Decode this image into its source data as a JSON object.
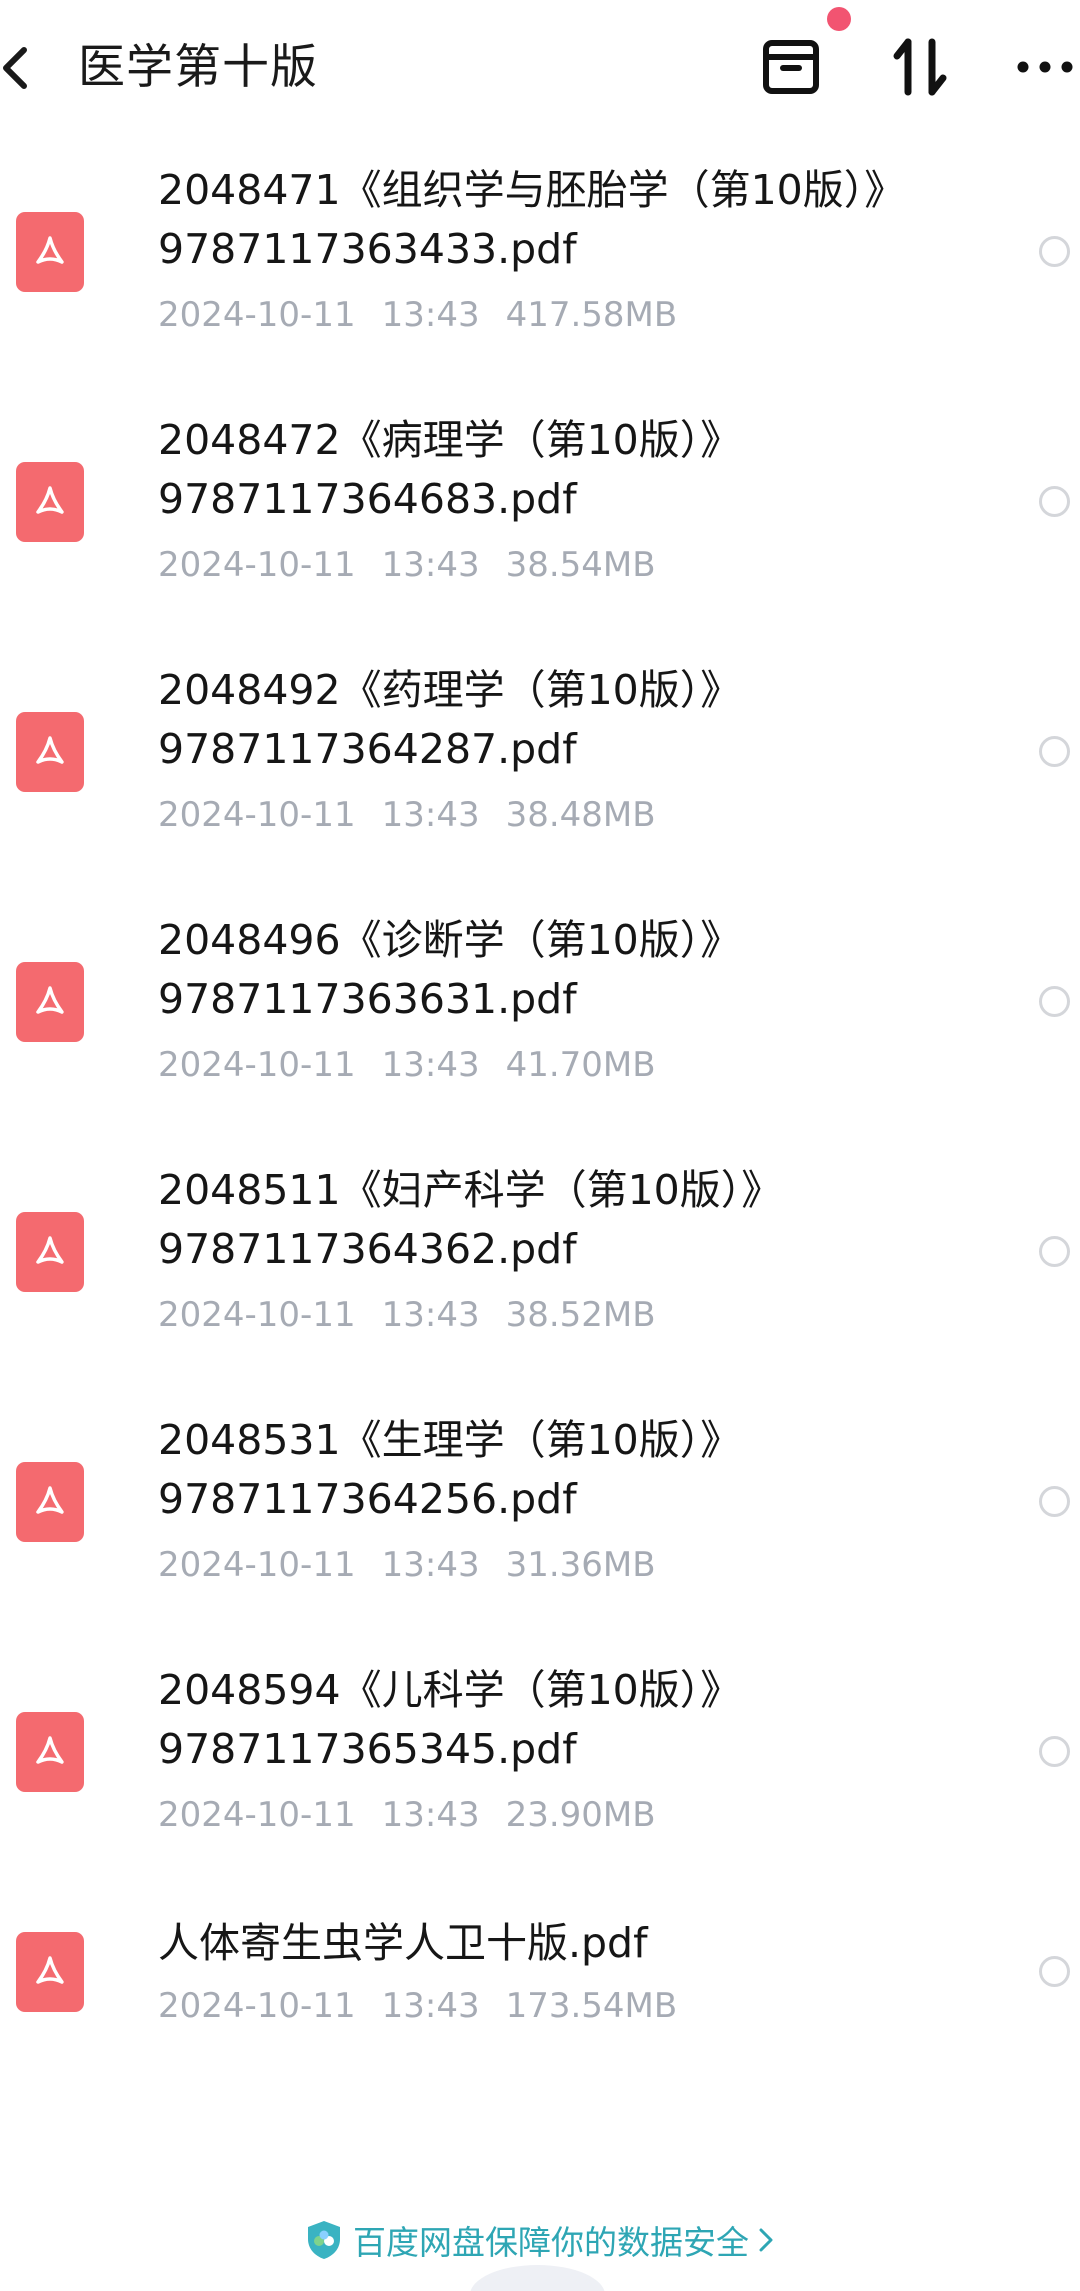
{
  "header": {
    "title": "医学第十版",
    "icons": {
      "back": "chevron-left-icon",
      "archive": "archive-box-icon",
      "sort": "sort-arrows-icon",
      "more": "more-dots-icon"
    },
    "notification_dot_color": "#f25471"
  },
  "files": [
    {
      "name_line1": "2048471《组织学与胚胎学（第10版）》",
      "name_line2": "9787117363433.pdf",
      "date": "2024-10-11",
      "time": "13:43",
      "size": "417.58MB",
      "icon": "pdf-file-icon"
    },
    {
      "name_line1": "2048472《病理学（第10版）》",
      "name_line2": "9787117364683.pdf",
      "date": "2024-10-11",
      "time": "13:43",
      "size": "38.54MB",
      "icon": "pdf-file-icon"
    },
    {
      "name_line1": "2048492《药理学（第10版）》",
      "name_line2": "9787117364287.pdf",
      "date": "2024-10-11",
      "time": "13:43",
      "size": "38.48MB",
      "icon": "pdf-file-icon"
    },
    {
      "name_line1": "2048496《诊断学（第10版）》",
      "name_line2": "9787117363631.pdf",
      "date": "2024-10-11",
      "time": "13:43",
      "size": "41.70MB",
      "icon": "pdf-file-icon"
    },
    {
      "name_line1": "2048511《妇产科学（第10版）》",
      "name_line2": "9787117364362.pdf",
      "date": "2024-10-11",
      "time": "13:43",
      "size": "38.52MB",
      "icon": "pdf-file-icon"
    },
    {
      "name_line1": "2048531《生理学（第10版）》",
      "name_line2": "9787117364256.pdf",
      "date": "2024-10-11",
      "time": "13:43",
      "size": "31.36MB",
      "icon": "pdf-file-icon"
    },
    {
      "name_line1": "2048594《儿科学（第10版）》",
      "name_line2": "9787117365345.pdf",
      "date": "2024-10-11",
      "time": "13:43",
      "size": "23.90MB",
      "icon": "pdf-file-icon"
    },
    {
      "name_line1": "人体寄生虫学人卫十版.pdf",
      "name_line2": "",
      "date": "2024-10-11",
      "time": "13:43",
      "size": "173.54MB",
      "icon": "pdf-file-icon"
    }
  ],
  "footer": {
    "notice": "百度网盘保障你的数据安全",
    "icon": "shield-icon",
    "arrow_icon": "chevron-right-icon",
    "accent_color": "#2ea6b4"
  },
  "colors": {
    "pdf_icon": "#f46a6f",
    "meta_text": "#a6abb4",
    "radio_border": "#d4d6da"
  }
}
